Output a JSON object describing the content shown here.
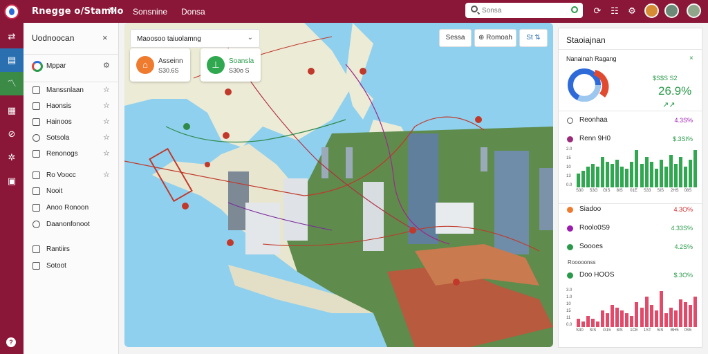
{
  "header": {
    "title": "Rnegge o/Stamllo",
    "tabs": [
      "Sonsnine",
      "Donsa"
    ],
    "search_placeholder": "Sonsa"
  },
  "left_panel": {
    "title": "Uodnoocan",
    "maps_label": "Mppar",
    "items": [
      {
        "label": "Manssnlaan",
        "starred": true
      },
      {
        "label": "Haonsis",
        "starred": true
      },
      {
        "label": "Hainoos",
        "starred": true
      },
      {
        "label": "Sotsola",
        "starred": true
      },
      {
        "label": "Renonogs",
        "starred": true
      },
      {
        "label": "Ro Voocc",
        "starred": true
      },
      {
        "label": "Nooit",
        "starred": false
      },
      {
        "label": "Anoo Ronoon",
        "starred": false
      },
      {
        "label": "Daanonfonoot",
        "starred": false
      },
      {
        "label": "Rantiirs",
        "starred": false
      },
      {
        "label": "Sotoot",
        "starred": false
      }
    ]
  },
  "map": {
    "layer_select": "Maoosoo taiuolamng",
    "cards": [
      {
        "title": "Asseinn",
        "value": "S30.6S",
        "color": "#ef7b2f",
        "icon": "home-icon"
      },
      {
        "title": "Soansla",
        "value": "S30o S",
        "color": "#2fa84f",
        "icon": "pin-icon"
      }
    ],
    "buttons": [
      "Sessa",
      "Romoah",
      "St"
    ]
  },
  "right_panel": {
    "title": "Staoiajnan",
    "summary_label": "Nanainah Ragang",
    "summary_value_small": "$S$S S2",
    "summary_value_big": "26.9%",
    "donut_colors": [
      "#2f6bd8",
      "#9cc7ef",
      "#e04a2f"
    ],
    "rows_top": [
      {
        "name": "Reonhaa",
        "value": "4.3S%",
        "dot": "#f0f0f0",
        "value_color": "#9c1cb0"
      },
      {
        "name": "Renn 9H0",
        "value": "$.3SI%",
        "dot": "#9c2a7a",
        "value_color": "#2a9a4a"
      }
    ],
    "chart1": {
      "type": "bar",
      "y_ticks": [
        "2.0",
        "15",
        "10",
        "13",
        "0.0"
      ],
      "x_labels": [
        "S30",
        "S3G",
        "GIS",
        "8IS",
        "01E",
        "S33",
        "SIS",
        "2HS",
        "08S"
      ],
      "values": [
        6,
        7,
        9,
        10,
        9,
        13,
        11,
        10,
        12,
        9,
        8,
        11,
        16,
        10,
        13,
        11,
        8,
        12,
        9,
        14,
        10,
        13,
        9,
        12,
        16
      ],
      "color": "#2fa84f"
    },
    "rows_mid": [
      {
        "name": "Siadoo",
        "value": "4.3O%",
        "dot": "#ef7b2f",
        "value_color": "#d02a2a"
      },
      {
        "name": "Roolo0S9",
        "value": "4.33S%",
        "dot": "#9c1cb0",
        "value_color": "#2a9a4a"
      },
      {
        "name": "Soooes",
        "value": "4.2S%",
        "dot": "#2a9a4a",
        "value_color": "#2a9a4a"
      }
    ],
    "section_label": "Rooooonss",
    "row_bottom": {
      "name": "Doo HOOS",
      "value": "$.3O%",
      "dot": "#2a9a4a",
      "value_color": "#2a9a4a"
    },
    "chart2": {
      "type": "bar",
      "y_ticks": [
        "3.0",
        "1.0",
        "10",
        "15",
        "11",
        "0.0"
      ],
      "x_labels": [
        "S30",
        "SIS",
        "G15",
        "8IS",
        "1CE",
        "1ST",
        "5IS",
        "BH5",
        "0S5"
      ],
      "values": [
        3,
        2,
        4,
        3,
        2,
        6,
        5,
        8,
        7,
        6,
        5,
        4,
        9,
        7,
        11,
        8,
        6,
        13,
        5,
        7,
        6,
        10,
        9,
        8,
        11
      ],
      "color": "#e24a6a"
    }
  }
}
